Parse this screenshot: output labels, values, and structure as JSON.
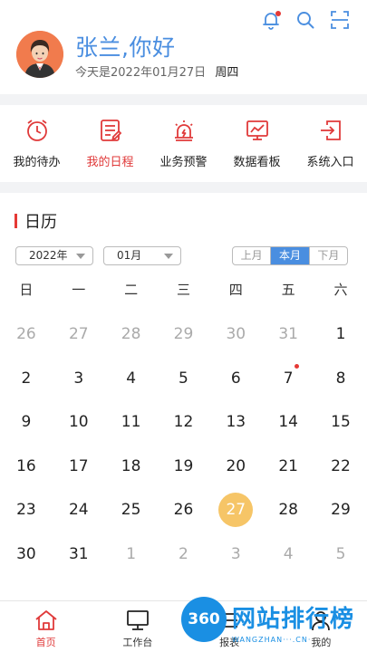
{
  "header": {
    "greeting": "张兰,你好",
    "date_prefix": "今天是2022年01月27日",
    "weekday": "周四",
    "icons": [
      "bell-icon",
      "search-icon",
      "scan-icon"
    ]
  },
  "quick_entries": [
    {
      "label": "我的待办",
      "icon": "clock-icon",
      "active": false
    },
    {
      "label": "我的日程",
      "icon": "schedule-icon",
      "active": true
    },
    {
      "label": "业务预警",
      "icon": "alarm-icon",
      "active": false
    },
    {
      "label": "数据看板",
      "icon": "dashboard-icon",
      "active": false
    },
    {
      "label": "系统入口",
      "icon": "login-icon",
      "active": false
    }
  ],
  "calendar": {
    "title": "日历",
    "year_select": "2022年",
    "month_select": "01月",
    "view_toggle": [
      "上月",
      "本月",
      "下月"
    ],
    "active_view": "本月",
    "weekdays": [
      "日",
      "一",
      "二",
      "三",
      "四",
      "五",
      "六"
    ],
    "weeks": [
      [
        "26",
        "27",
        "28",
        "29",
        "30",
        "31",
        "1"
      ],
      [
        "2",
        "3",
        "4",
        "5",
        "6",
        "7",
        "8"
      ],
      [
        "9",
        "10",
        "11",
        "12",
        "13",
        "14",
        "15"
      ],
      [
        "16",
        "17",
        "18",
        "19",
        "20",
        "21",
        "22"
      ],
      [
        "23",
        "24",
        "25",
        "26",
        "27",
        "28",
        "29"
      ],
      [
        "30",
        "31",
        "1",
        "2",
        "3",
        "4",
        "5"
      ]
    ],
    "today": "27",
    "event_dot_day": "7"
  },
  "tabbar": {
    "tabs": [
      {
        "label": "首页",
        "icon": "home-icon",
        "active": true
      },
      {
        "label": "工作台",
        "icon": "monitor-icon",
        "active": false
      },
      {
        "label": "报表",
        "icon": "report-icon",
        "active": false
      },
      {
        "label": "我的",
        "icon": "user-icon",
        "active": false
      }
    ]
  },
  "watermark": {
    "badge": "360",
    "text": "网站排行榜",
    "sub": "WANGZHAN···.CN·"
  },
  "colors": {
    "accent_red": "#e03a3a",
    "accent_blue": "#4a8ee0",
    "today_yellow": "#f6c567"
  }
}
